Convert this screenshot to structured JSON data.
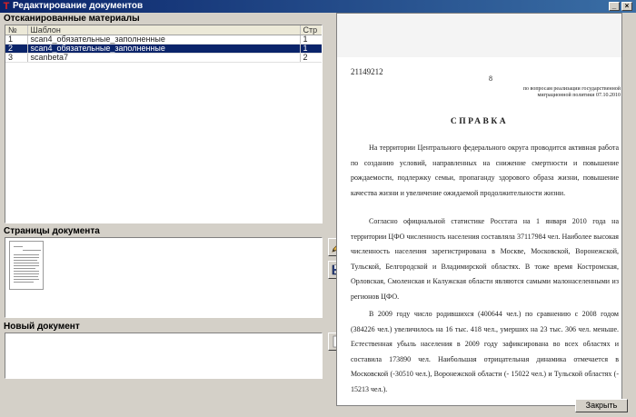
{
  "window": {
    "title": "Редактирование документов"
  },
  "scanned": {
    "label": "Отсканированные материалы",
    "columns": {
      "num": "№",
      "template": "Шаблон",
      "page": "Стр"
    },
    "rows": [
      {
        "num": "1",
        "template": "scan4_обязательные_заполненные",
        "page": "1"
      },
      {
        "num": "2",
        "template": "scan4_обязательные_заполненные",
        "page": "1"
      },
      {
        "num": "3",
        "template": "scanbeta7",
        "page": "2"
      }
    ]
  },
  "pages": {
    "label": "Страницы документа"
  },
  "new_doc": {
    "label": "Новый документ"
  },
  "document": {
    "number": "21149212",
    "small_number": "8",
    "org_line1": "по вопросам реализации государственной",
    "org_line2": "миграционной политики  07.10.2010",
    "heading": "СПРАВКА",
    "p1": "На территории Центрального федерального округа проводится активная работа  по созданию условий, направленных на снижение смертности и повышение рождаемости, подлержку семьи, пропаганду здорового образа жизни, повышение качества жизни и увеличение ожидаемой продолжительности жизни.",
    "p2": "Согласно официальной статистике Росстата на 1 января 2010 года на территории ЦФО численность населения составляла  37117984 чел. Наиболее высокая численность населения зарегистрирована в Москве, Московской, Воронежской, Тульской, Белгородской и Владимирской областях. В тоже время Костромская, Орловская, Смоленская и Калужская области являются самыми малонаселенными из регионов ЦФО.",
    "p3": "В 2009 году число родившихся (400644 чел.) по сравнению с 2008 годом (384226 чел.) увеличилось на 16 тыс. 418 чел., умерших на 23 тыс. 306 чел. меньше. Естественная убыль населения в 2009 году зафиксирована во всех областях и составила  173890 чел. Наибольшая отрицательная динамика отмечается в Московской (-30510 чел.), Воронежской области (- 15022 чел.) и Тульской областях (- 15213 чел.)."
  },
  "buttons": {
    "close": "Закрыть",
    "minimize": "_",
    "close_window": "×"
  },
  "icons": {
    "app": "app-icon",
    "edit": "pencil-icon",
    "save": "floppy-disk-icon",
    "add": "add-document-icon"
  }
}
